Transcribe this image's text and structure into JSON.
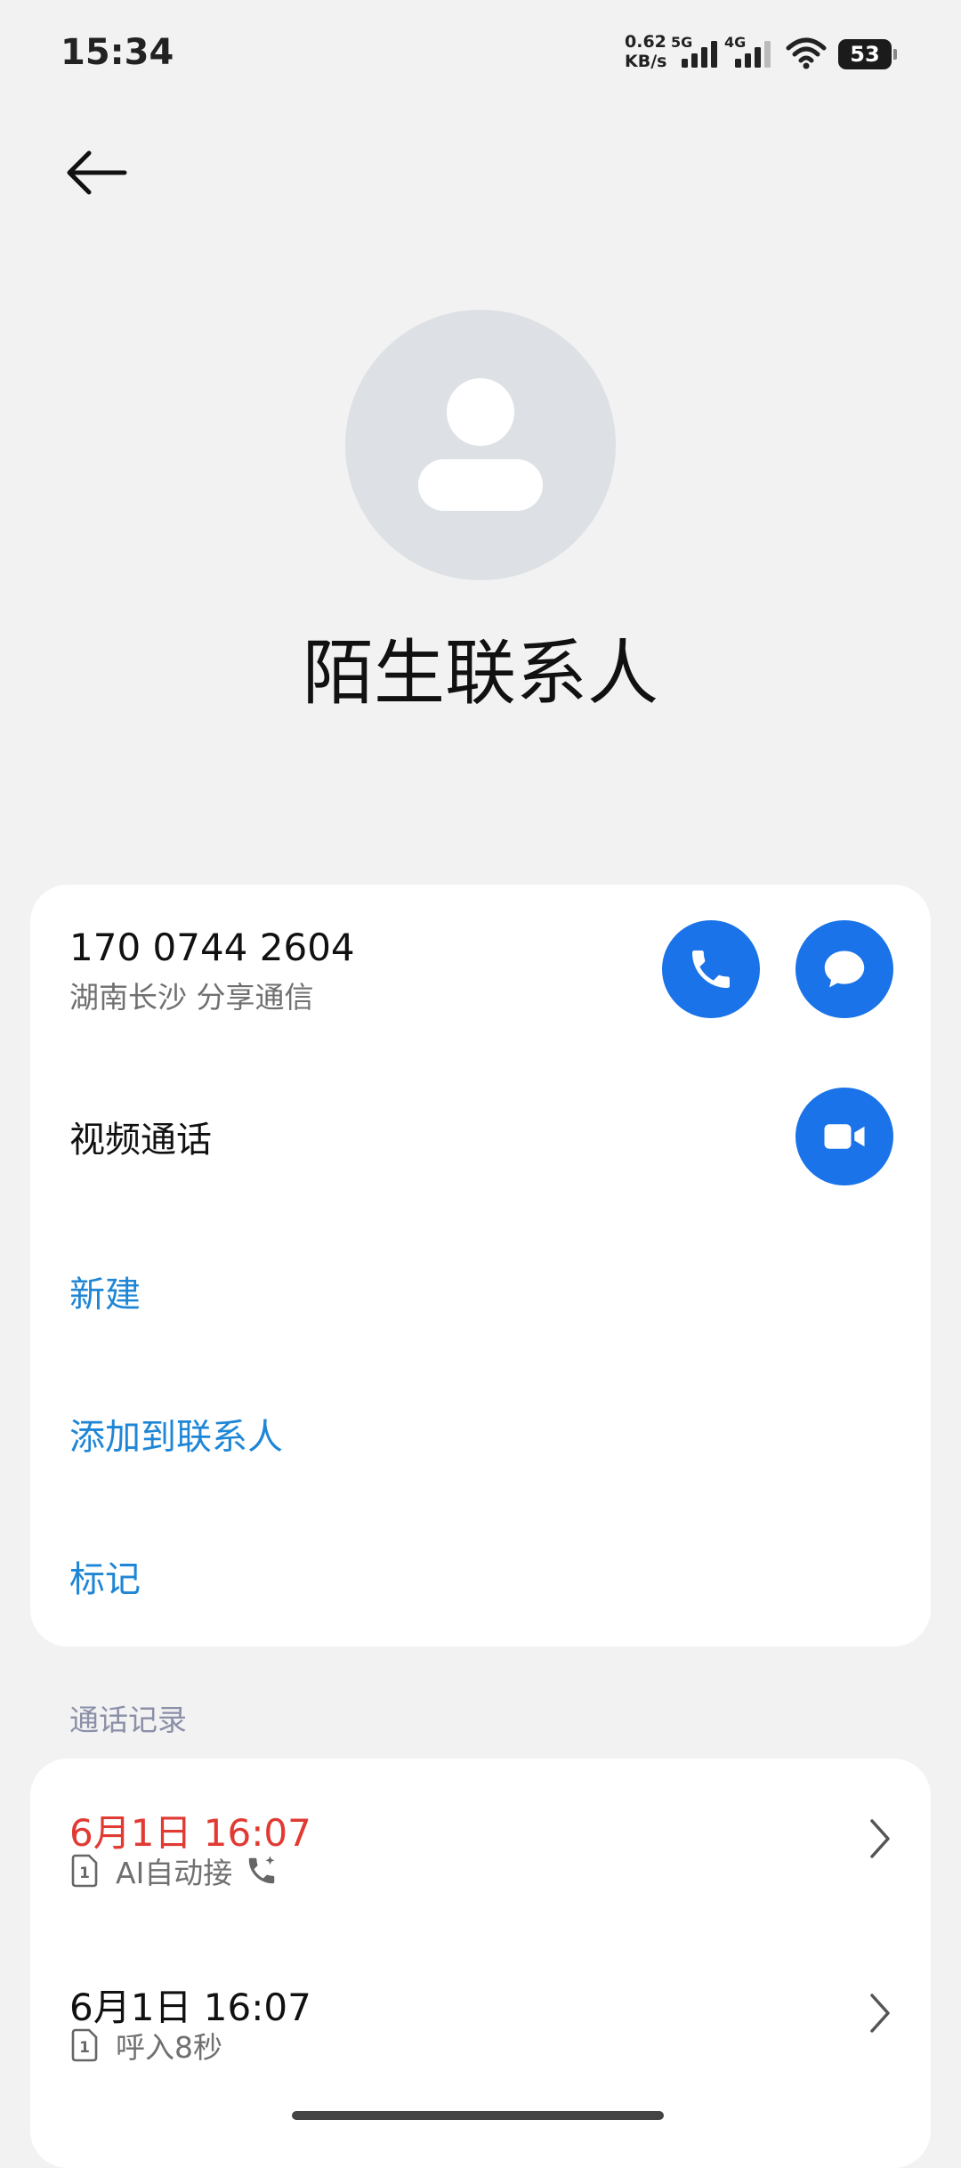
{
  "status_bar": {
    "time": "15:34",
    "speed_value": "0.62",
    "speed_unit": "KB/s",
    "sim1_label": "5G",
    "sim2_label": "4G",
    "battery": "53"
  },
  "header": {
    "back_icon": "arrow-left-icon"
  },
  "contact": {
    "avatar_icon": "person-placeholder-icon",
    "name": "陌生联系人"
  },
  "main_card": {
    "number": "170 0744 2604",
    "location": "湖南长沙 分享通信",
    "call_icon": "phone-icon",
    "message_icon": "message-icon",
    "video_label": "视频通话",
    "video_icon": "video-camera-icon",
    "actions": [
      "新建",
      "添加到联系人",
      "标记"
    ]
  },
  "call_log": {
    "title": "通话记录",
    "entries": [
      {
        "time": "6月1日 16:07",
        "time_color": "#e03a32",
        "sim": "1",
        "detail": "AI自动接",
        "detail_icon": "phone-ai-icon"
      },
      {
        "time": "6月1日 16:07",
        "time_color": "#111111",
        "sim": "1",
        "detail": "呼入8秒"
      }
    ]
  },
  "colors": {
    "accent": "#1a73e8",
    "link": "#1f86d6",
    "missed": "#e03a32",
    "background": "#f2f2f2"
  }
}
